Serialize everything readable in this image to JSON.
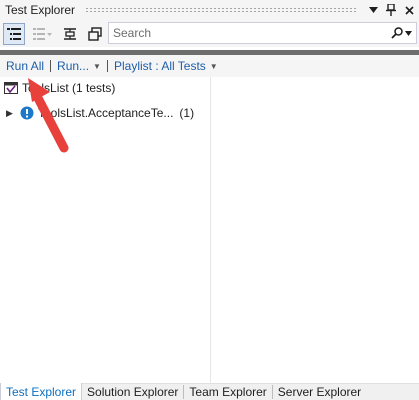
{
  "window": {
    "title": "Test Explorer"
  },
  "titlebar_icons": [
    "dropdown-icon",
    "pin-icon",
    "close-icon"
  ],
  "toolbar": {
    "search_placeholder": "Search"
  },
  "commands": {
    "run_all": "Run All",
    "run": "Run...",
    "playlist": "Playlist : All Tests"
  },
  "tree": {
    "root_label": "ToolsList (1 tests)",
    "child_label": "ToolsList.AcceptanceTe...",
    "child_count": "(1)"
  },
  "tabs": [
    {
      "label": "Test Explorer",
      "active": true
    },
    {
      "label": "Solution Explorer"
    },
    {
      "label": "Team Explorer"
    },
    {
      "label": "Server Explorer"
    }
  ],
  "colors": {
    "accent_link": "#1e5ea8",
    "active_tab": "#0e70c0",
    "annotation_arrow": "#e8413b",
    "warning_badge": "#1e78c8"
  }
}
